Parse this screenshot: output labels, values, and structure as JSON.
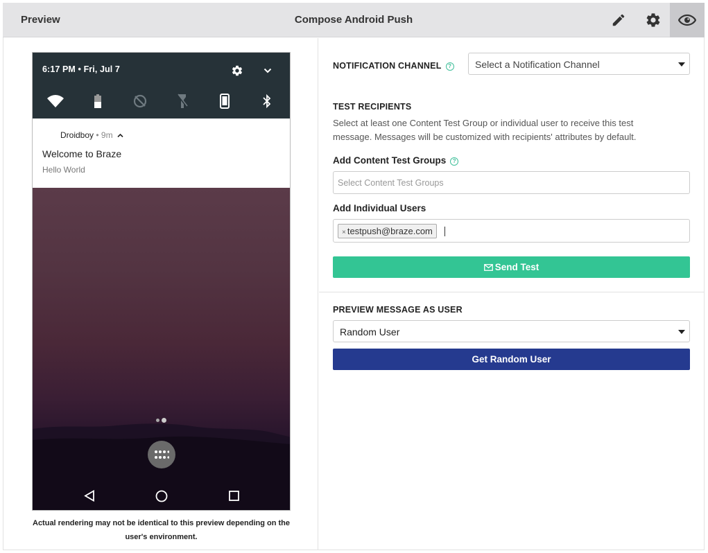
{
  "header": {
    "left_title": "Preview",
    "center_title": "Compose Android Push",
    "icons": [
      "pencil-icon",
      "gear-icon",
      "eye-icon"
    ]
  },
  "phone": {
    "status_time": "6:17 PM • Fri, Jul 7",
    "quick_settings": [
      "wifi-icon",
      "battery-icon",
      "data-saver-icon",
      "flashlight-icon",
      "phone-icon",
      "bluetooth-icon"
    ],
    "notification": {
      "app_name": "Droidboy",
      "time": " • 9m",
      "title": "Welcome to Braze",
      "body": "Hello World"
    },
    "disclaimer": "Actual rendering may not be identical to this preview depending on the user's environment."
  },
  "form": {
    "notification_channel": {
      "label": "NOTIFICATION CHANNEL",
      "help": "?",
      "value": "Select a Notification Channel"
    },
    "test_recipients": {
      "heading": "TEST RECIPIENTS",
      "description": "Select at least one Content Test Group or individual user to receive this test message. Messages will be customized with recipients' attributes by default.",
      "groups_label": "Add Content Test Groups",
      "groups_help": "?",
      "groups_placeholder": "Select Content Test Groups",
      "users_label": "Add Individual Users",
      "user_chip": "testpush@braze.com",
      "chip_remove": "×",
      "send_button": "Send Test"
    },
    "preview_as_user": {
      "heading": "PREVIEW MESSAGE AS USER",
      "value": "Random User",
      "button": "Get Random User"
    }
  },
  "colors": {
    "green": "#33c594",
    "navy": "#253a8f",
    "status_bar": "#263238",
    "header_bg": "#e4e4e6"
  }
}
